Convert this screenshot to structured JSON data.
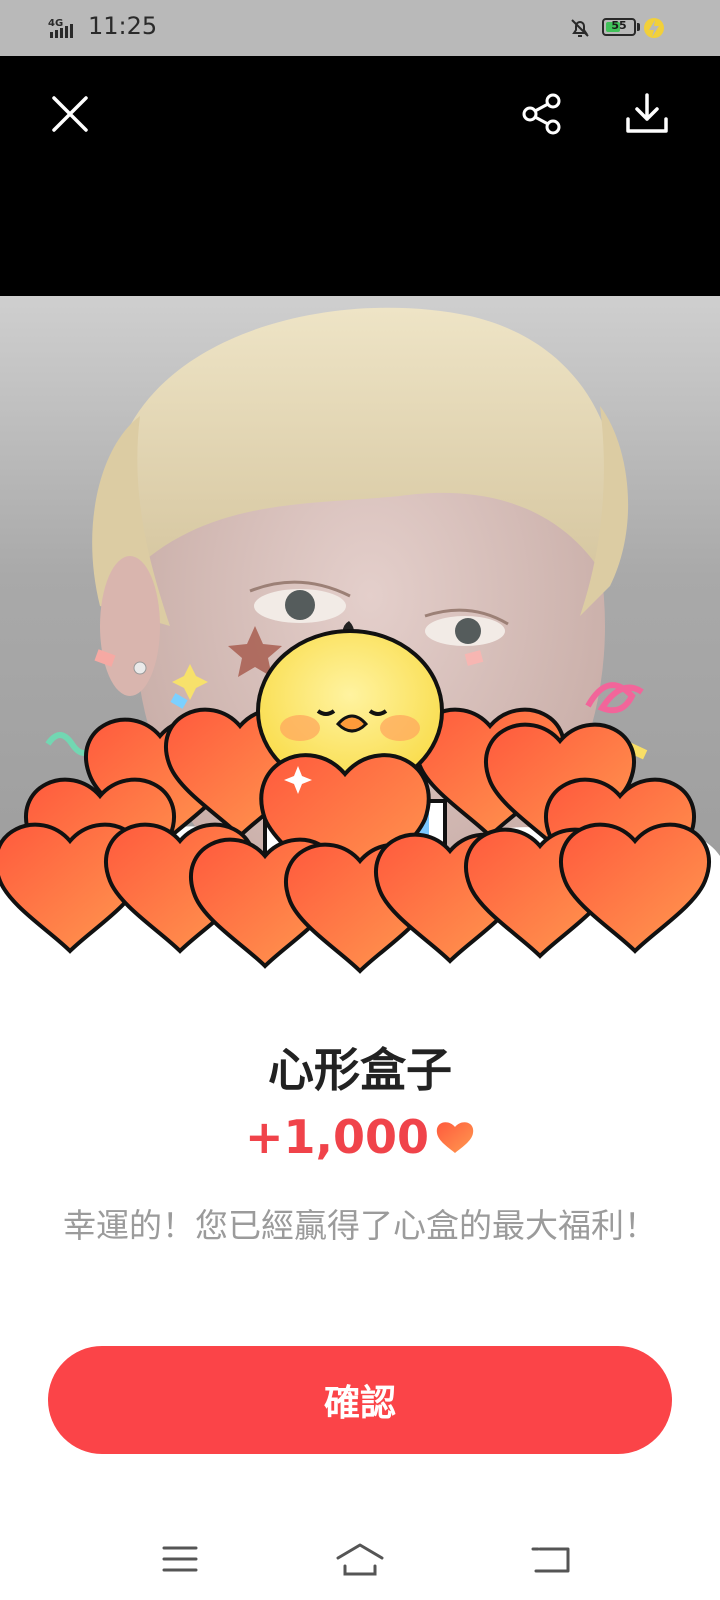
{
  "status_bar": {
    "network": "4G",
    "time": "11:25",
    "battery_level": "55",
    "battery_fraction": 0.55,
    "icons": [
      "signal-icon",
      "bell-off-icon",
      "battery-icon",
      "charging-icon"
    ]
  },
  "toolbar": {
    "icons": [
      "close-icon",
      "share-icon",
      "download-icon"
    ]
  },
  "dialog": {
    "title": "心形盒子",
    "reward_amount": "+1,000",
    "reward_icon": "heart-icon",
    "message": "幸運的！您已經贏得了心盒的最大福利！",
    "confirm_label": "確認"
  },
  "colors": {
    "accent": "#fb4448",
    "reward_text": "#f0434a",
    "message_text": "#9b9b9b",
    "title_text": "#222222",
    "topbar": "#000000"
  },
  "nav_bar": {
    "icons": [
      "menu-icon",
      "home-icon",
      "back-icon"
    ]
  }
}
